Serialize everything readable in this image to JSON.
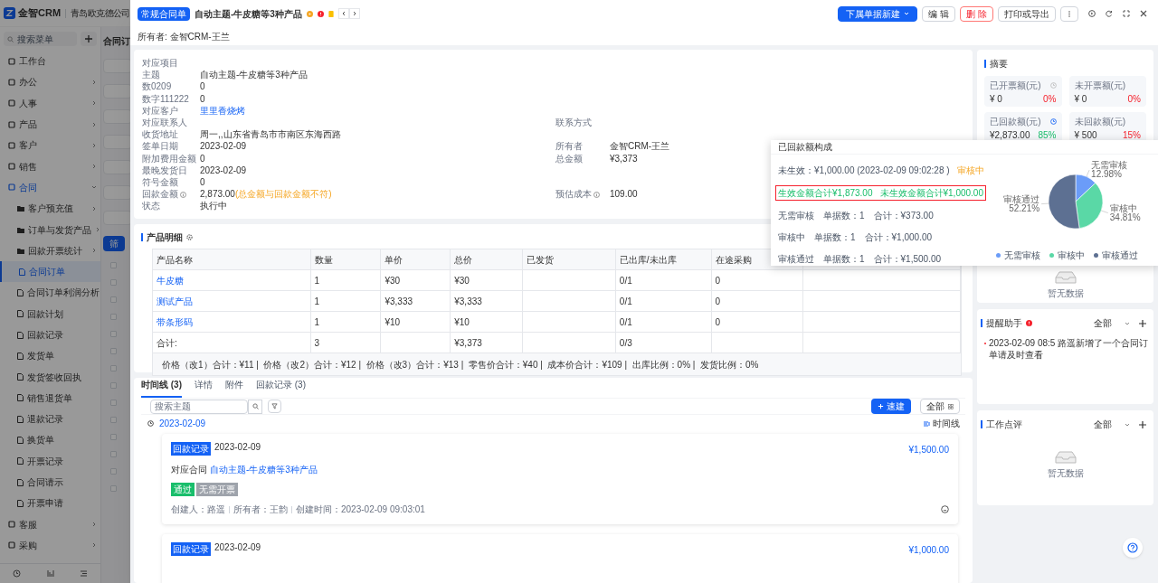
{
  "app": {
    "logo_text": "金智CRM",
    "company": "青岛欧克德公司",
    "search_placeholder": "搜索菜单",
    "list_title": "合同订",
    "filter_button": "筛",
    "list_rows": [
      {
        "checked": false
      },
      {
        "checked": false
      },
      {
        "checked": false
      },
      {
        "checked": false
      },
      {
        "checked": false
      },
      {
        "checked": false
      },
      {
        "checked": false
      },
      {
        "checked": false
      },
      {
        "checked": false
      },
      {
        "checked": false
      },
      {
        "checked": false
      },
      {
        "checked": false
      },
      {
        "checked": false
      },
      {
        "checked": false
      }
    ]
  },
  "sidebar": {
    "items": [
      {
        "label": "工作台",
        "kind": "link",
        "selected": false
      },
      {
        "label": "办公",
        "kind": "group",
        "expanded": false,
        "selected": false
      },
      {
        "label": "人事",
        "kind": "group",
        "expanded": false,
        "selected": false
      },
      {
        "label": "产品",
        "kind": "group",
        "expanded": false,
        "selected": false
      },
      {
        "label": "客户",
        "kind": "group",
        "expanded": false,
        "selected": false
      },
      {
        "label": "销售",
        "kind": "group",
        "expanded": false,
        "selected": false
      },
      {
        "label": "合同",
        "kind": "group",
        "expanded": true,
        "selected": false,
        "children": [
          {
            "label": "客户预充值",
            "kind": "group",
            "expanded": false,
            "selected": false
          },
          {
            "label": "订单与发货产品",
            "kind": "group",
            "expanded": false,
            "selected": false
          },
          {
            "label": "回款开票统计",
            "kind": "group",
            "expanded": false,
            "selected": false
          },
          {
            "label": "合同订单",
            "kind": "link",
            "selected": true
          },
          {
            "label": "合同订单利润分析",
            "kind": "link",
            "selected": false
          },
          {
            "label": "回款计划",
            "kind": "link",
            "selected": false
          },
          {
            "label": "回款记录",
            "kind": "link",
            "selected": false
          },
          {
            "label": "发货单",
            "kind": "link",
            "selected": false
          },
          {
            "label": "发货签收回执",
            "kind": "link",
            "selected": false
          },
          {
            "label": "销售退货单",
            "kind": "link",
            "selected": false
          },
          {
            "label": "退款记录",
            "kind": "link",
            "selected": false
          },
          {
            "label": "换货单",
            "kind": "link",
            "selected": false
          },
          {
            "label": "开票记录",
            "kind": "link",
            "selected": false
          },
          {
            "label": "合同请示",
            "kind": "link",
            "selected": false
          },
          {
            "label": "开票申请",
            "kind": "link",
            "selected": false
          }
        ]
      },
      {
        "label": "客服",
        "kind": "group",
        "expanded": false,
        "selected": false
      },
      {
        "label": "采购",
        "kind": "group",
        "expanded": false,
        "selected": false
      }
    ]
  },
  "header": {
    "tag": "常规合同单",
    "title": "自动主题-牛皮糖等3种产品",
    "buttons": [
      {
        "label": "下属单据新建",
        "kind": "primary"
      },
      {
        "label": "编 辑",
        "kind": "default"
      },
      {
        "label": "删 除",
        "kind": "danger"
      },
      {
        "label": "打印或导出",
        "kind": "default"
      }
    ],
    "owner": "所有者: 金智CRM-王兰"
  },
  "details": {
    "fields": [
      {
        "label": "对应项目"
      },
      {
        "label": "主题",
        "value": "自动主题-牛皮糖等3种产品"
      },
      {
        "label": "数0209",
        "value": "0"
      },
      {
        "label": "数字111222",
        "value": "0"
      },
      {
        "label": "对应客户",
        "value": "里里香烧烤",
        "kind": "link"
      },
      {
        "label": "对应联系人",
        "right_label": "联系方式"
      },
      {
        "label": "收货地址",
        "value": "周一,,山东省青岛市市南区东海西路"
      },
      {
        "label": "签单日期",
        "value": "2023-02-09",
        "right_label": "所有者",
        "right_value": "金智CRM-王兰"
      },
      {
        "label": "附加费用金额",
        "value": "0",
        "right_label": "总金额",
        "right_value": "¥3,373"
      },
      {
        "label": "最晚发货日",
        "value": "2023-02-09"
      },
      {
        "label": "符号金额",
        "value": "0"
      },
      {
        "label": "回款金额",
        "info": true,
        "value": "2,873.00",
        "warning": "(总金额与回款金额不符)",
        "right_label": "预估成本",
        "right_info": true,
        "right_value": "109.00"
      },
      {
        "label": "状态",
        "value": "执行中"
      }
    ]
  },
  "products": {
    "title": "产品明细",
    "columns": [
      "产品名称",
      "数量",
      "单价",
      "总价",
      "已发货",
      "已出库/未出库",
      "在途采购"
    ],
    "rows": [
      {
        "kind": "item",
        "cells": [
          "牛皮糖",
          "1",
          "¥30",
          "¥30",
          "",
          "0/1",
          "0"
        ]
      },
      {
        "kind": "item",
        "cells": [
          "测试产品",
          "1",
          "¥3,333",
          "¥3,333",
          "",
          "0/1",
          "0"
        ]
      },
      {
        "kind": "item",
        "cells": [
          "带条形码",
          "1",
          "¥10",
          "¥10",
          "",
          "0/1",
          "0"
        ]
      },
      {
        "kind": "total",
        "cells": [
          "合计:",
          "3",
          "",
          "¥3,373",
          "",
          "0/3",
          ""
        ]
      }
    ],
    "footer": "价格（改1）合计：¥11 |  价格（改2）合计：¥12 |  价格（改3）合计：¥13 |  零售价合计：¥40 |  成本价合计：¥109 |  出库比例：0% |  发货比例：0%"
  },
  "timeline": {
    "tabs": [
      {
        "label": "时间线 (3)",
        "selected": true
      },
      {
        "label": "详情",
        "selected": false
      },
      {
        "label": "附件",
        "selected": false
      },
      {
        "label": "回款记录 (3)",
        "selected": false
      }
    ],
    "search_placeholder": "搜索主题",
    "quick_create": "速建",
    "scope": "全部",
    "date": "2023-02-09",
    "view_label": "时间线",
    "entries": [
      {
        "tag": "回款记录",
        "date": "2023-02-09",
        "amount": "¥1,500.00",
        "contract_label": "对应合同",
        "contract_link": "自动主题-牛皮糖等3种产品",
        "badges": [
          {
            "label": "通过",
            "kind": "success"
          },
          {
            "label": "无需开票",
            "kind": "muted"
          }
        ],
        "meta": [
          "创建人：路遥",
          "所有者：王韵",
          "创建时间：2023-02-09 09:03:01"
        ]
      },
      {
        "tag": "回款记录",
        "date": "2023-02-09",
        "amount": "¥1,000.00"
      }
    ]
  },
  "summary": {
    "title": "摘要",
    "stats": [
      {
        "label": "已开票额(元)",
        "value": "¥ 0",
        "percent": "0%",
        "kind": "negative",
        "clock": true,
        "clock_highlighted": false
      },
      {
        "label": "未开票额(元)",
        "value": "¥ 0",
        "percent": "0%",
        "kind": "negative"
      },
      {
        "label": "已回款额(元)",
        "value": "¥2,873.00",
        "percent": "85%",
        "kind": "positive",
        "clock": true,
        "clock_highlighted": true
      },
      {
        "label": "未回款额(元)",
        "value": "¥ 500",
        "percent": "15%",
        "kind": "negative"
      }
    ],
    "empty_text": "暂无数据"
  },
  "popover": {
    "title": "已回款额构成",
    "pending": "未生效：¥1,000.00 (2023-02-09 09:02:28 )",
    "pending_status": "审核中",
    "totals": [
      "生效金额合计¥1,873.00",
      "未生效金额合计¥1,000.00"
    ],
    "rows": [
      {
        "name": "无需审核",
        "count": "单据数：1",
        "sum": "合计：¥373.00"
      },
      {
        "name": "审核中",
        "count": "单据数：1",
        "sum": "合计：¥1,000.00"
      },
      {
        "name": "审核通过",
        "count": "单据数：1",
        "sum": "合计：¥1,500.00"
      }
    ],
    "chart_data": {
      "type": "pie",
      "categories": [
        "无需审核",
        "审核中",
        "审核通过"
      ],
      "values": [
        12.98,
        34.81,
        52.21
      ],
      "colors": [
        "#6b9cf8",
        "#5ad8a6",
        "#5d7092"
      ],
      "value_labels": [
        "12.98%",
        "34.81%",
        "52.21%"
      ],
      "legend": "bottom"
    }
  },
  "reminder": {
    "title": "提醒助手",
    "filter": "全部",
    "entries": [
      "2023-02-09 08:5  路遥新增了一个合同订单请及时查看"
    ]
  },
  "review": {
    "title": "工作点评",
    "filter": "全部",
    "empty_text": "暂无数据"
  }
}
